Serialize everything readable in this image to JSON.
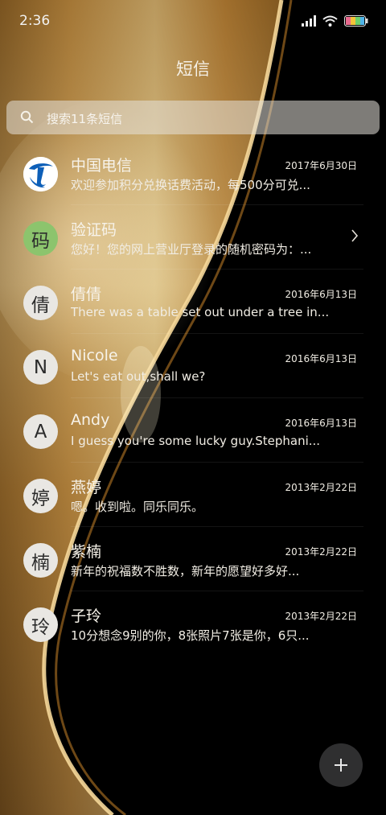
{
  "status_bar": {
    "time": "2:36"
  },
  "header": {
    "title": "短信"
  },
  "search": {
    "placeholder": "搜索11条短信"
  },
  "conversations": [
    {
      "name": "中国电信",
      "date": "2017年6月30日",
      "preview": "欢迎参加积分兑换话费活动，每500分可兑...",
      "avatar_icon": "china-telecom-logo-icon"
    },
    {
      "name": "验证码",
      "date": "",
      "preview": "您好！您的网上营业厅登录的随机密码为：...",
      "avatar_text": "码"
    },
    {
      "name": "倩倩",
      "date": "2016年6月13日",
      "preview": "There was a table set out under a tree in...",
      "avatar_text": "倩"
    },
    {
      "name": "Nicole",
      "date": "2016年6月13日",
      "preview": "Let's eat out,shall we?",
      "avatar_text": "N"
    },
    {
      "name": "Andy",
      "date": "2016年6月13日",
      "preview": "I guess you're some lucky guy.Stephani...",
      "avatar_text": "A"
    },
    {
      "name": "燕婷",
      "date": "2013年2月22日",
      "preview": "嗯。收到啦。同乐同乐。",
      "avatar_text": "婷"
    },
    {
      "name": "紫楠",
      "date": "2013年2月22日",
      "preview": "新年的祝福数不胜数，新年的愿望好多好...",
      "avatar_text": "楠"
    },
    {
      "name": "子玲",
      "date": "2013年2月22日",
      "preview": "10分想念9别的你，8张照片7张是你，6只...",
      "avatar_text": "玲"
    }
  ],
  "colors": {
    "accent_gold": "#c8963c",
    "avatar_green": "#8cc46d",
    "fab_bg": "#2f2f30",
    "telecom_blue": "#0d5fb8"
  },
  "icons": {
    "search": "search-icon",
    "wifi": "wifi-icon",
    "signal": "signal-icon",
    "battery": "battery-icon",
    "chevron": "chevron-right-icon",
    "fab": "plus-icon"
  }
}
